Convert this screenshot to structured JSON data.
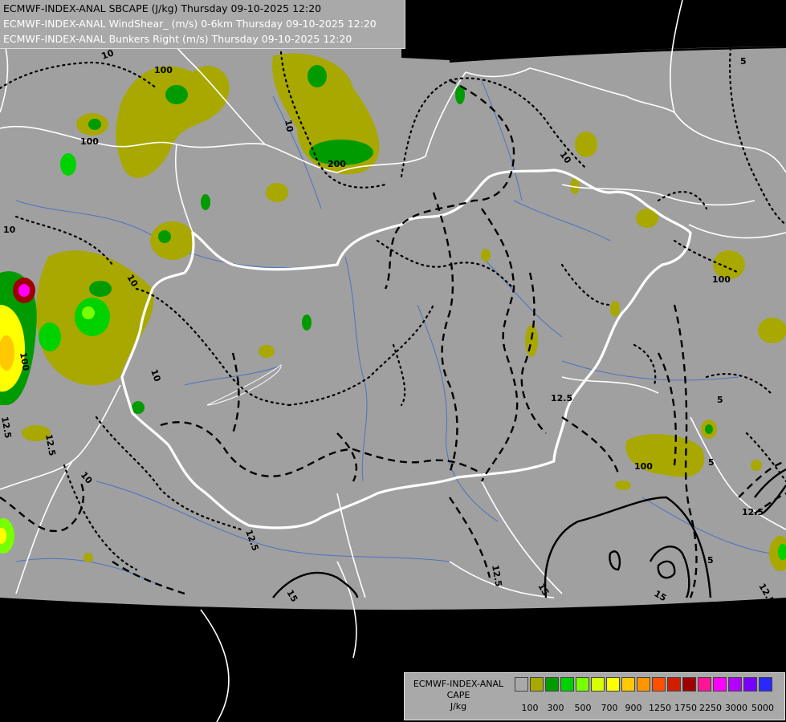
{
  "header": {
    "line1": "ECMWF-INDEX-ANAL SBCAPE (J/kg) Thursday 09-10-2025 12:20",
    "line2": "ECMWF-INDEX-ANAL WindShear_ (m/s) 0-6km Thursday 09-10-2025 12:20",
    "line3": "ECMWF-INDEX-ANAL Bunkers Right (m/s) Thursday 09-10-2025 12:20"
  },
  "legend": {
    "model": "ECMWF-INDEX-ANAL",
    "variable": "CAPE",
    "unit": "J/kg",
    "colors": [
      "#a9a9a9",
      "#a8a800",
      "#009b00",
      "#00d200",
      "#78ff00",
      "#d8ff00",
      "#ffff00",
      "#ffc800",
      "#ff9600",
      "#ff5000",
      "#d21e00",
      "#a00000",
      "#ff1493",
      "#ff00ff",
      "#b400ff",
      "#7800ff",
      "#2828ff",
      "#0096ff",
      "#00dcff",
      "#78ffff",
      "#ffffff"
    ],
    "tick_labels": [
      "100",
      "300",
      "500",
      "700",
      "900",
      "1250",
      "1750",
      "2250",
      "3000",
      "5000"
    ]
  },
  "contour_labels": {
    "shear_values": [
      "10",
      "10",
      "10",
      "10",
      "10",
      "10",
      "10",
      "12.5",
      "12.5",
      "12.5",
      "12.5",
      "12.5",
      "12.5",
      "12.5",
      "15",
      "15",
      "15",
      "5",
      "5",
      "5",
      "5"
    ],
    "cape_values": [
      "100",
      "100",
      "100",
      "100",
      "100",
      "200"
    ]
  }
}
